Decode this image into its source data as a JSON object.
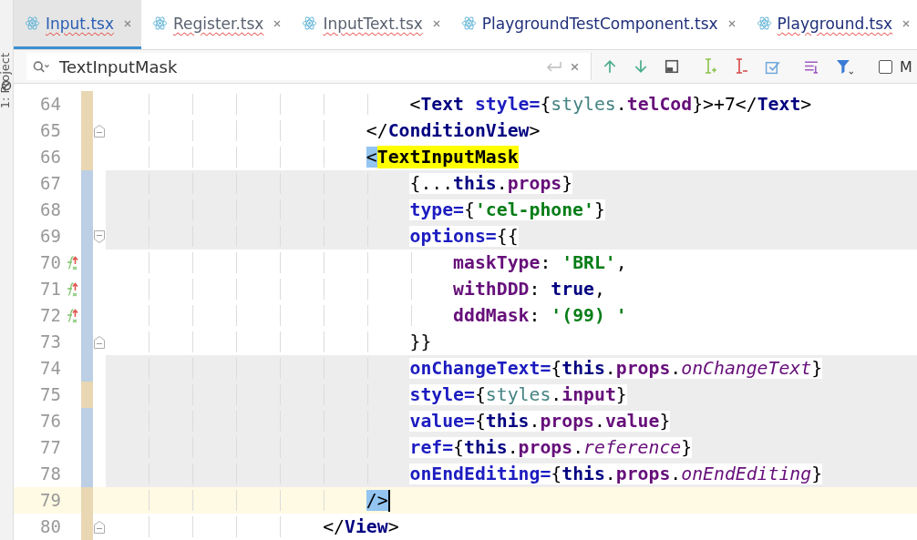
{
  "side_panel": {
    "label": "1: Project"
  },
  "tabs": [
    {
      "label": "Input.tsx",
      "selected": true,
      "has_errors": true,
      "color": "#2c5fb3"
    },
    {
      "label": "Register.tsx",
      "selected": false,
      "has_errors": true,
      "color": "#5a6270"
    },
    {
      "label": "InputText.tsx",
      "selected": false,
      "has_errors": true,
      "color": "#5a6270"
    },
    {
      "label": "PlaygroundTestComponent.tsx",
      "selected": false,
      "has_errors": false,
      "color": "#1f2f7a"
    },
    {
      "label": "Playground.tsx",
      "selected": false,
      "has_errors": true,
      "color": "#1f2f7a"
    }
  ],
  "search": {
    "value": "TextInputMask",
    "match_case": {
      "label": "M",
      "checked": false
    }
  },
  "lines": [
    {
      "number": "64",
      "modified": true,
      "highlighted": false,
      "current": false,
      "fold_start": false,
      "fold_end": false,
      "inline_icon": false,
      "tokens": [
        {
          "plain": "                            <"
        },
        {
          "tag": "Text"
        },
        {
          "attr": " style="
        },
        {
          "plain": "{"
        },
        {
          "ref": "styles"
        },
        {
          "plain": "."
        },
        {
          "prop": "telCod"
        },
        {
          "plain": "}>+7</"
        },
        {
          "tag": "Text"
        },
        {
          "plain": ">"
        }
      ]
    },
    {
      "number": "65",
      "modified": true,
      "highlighted": false,
      "current": false,
      "fold_start": false,
      "fold_end": true,
      "inline_icon": false,
      "tokens": [
        {
          "plain": "                        </"
        },
        {
          "tag": "ConditionView"
        },
        {
          "plain": ">"
        }
      ]
    },
    {
      "number": "66",
      "modified": true,
      "highlighted": false,
      "current": false,
      "fold_start": false,
      "fold_end": false,
      "inline_icon": false,
      "tokens": [
        {
          "match": "                        <"
        },
        {
          "search": "TextInputMask"
        }
      ]
    },
    {
      "number": "67",
      "modified": false,
      "highlighted": true,
      "current": false,
      "fold_start": false,
      "fold_end": false,
      "inline_icon": false,
      "tokens": [
        {
          "plain": "                            {..."
        },
        {
          "kw": "this"
        },
        {
          "plain": "."
        },
        {
          "prop": "props"
        },
        {
          "plain": "}"
        }
      ]
    },
    {
      "number": "68",
      "modified": false,
      "highlighted": true,
      "current": false,
      "fold_start": false,
      "fold_end": false,
      "inline_icon": false,
      "tokens": [
        {
          "attr": "                            type="
        },
        {
          "plain": "{"
        },
        {
          "str": "'cel-phone'"
        },
        {
          "plain": "}"
        }
      ]
    },
    {
      "number": "69",
      "modified": false,
      "highlighted": true,
      "current": false,
      "fold_start": true,
      "fold_end": false,
      "inline_icon": false,
      "tokens": [
        {
          "attr": "                            options="
        },
        {
          "plain": "{{"
        }
      ]
    },
    {
      "number": "70",
      "modified": false,
      "highlighted": false,
      "current": false,
      "fold_start": false,
      "fold_end": false,
      "inline_icon": true,
      "tokens": [
        {
          "prop": "                                maskType"
        },
        {
          "plain": ": "
        },
        {
          "str": "'BRL'"
        },
        {
          "plain": ","
        }
      ]
    },
    {
      "number": "71",
      "modified": false,
      "highlighted": false,
      "current": false,
      "fold_start": false,
      "fold_end": false,
      "inline_icon": true,
      "tokens": [
        {
          "prop": "                                withDDD"
        },
        {
          "plain": ": "
        },
        {
          "kw": "true"
        },
        {
          "plain": ","
        }
      ]
    },
    {
      "number": "72",
      "modified": false,
      "highlighted": false,
      "current": false,
      "fold_start": false,
      "fold_end": false,
      "inline_icon": true,
      "tokens": [
        {
          "prop": "                                dddMask"
        },
        {
          "plain": ": "
        },
        {
          "str": "'(99) '"
        }
      ]
    },
    {
      "number": "73",
      "modified": false,
      "highlighted": false,
      "current": false,
      "fold_start": false,
      "fold_end": true,
      "inline_icon": false,
      "tokens": [
        {
          "plain": "                            }}"
        }
      ]
    },
    {
      "number": "74",
      "modified": false,
      "highlighted": true,
      "current": false,
      "fold_start": false,
      "fold_end": false,
      "inline_icon": false,
      "tokens": [
        {
          "attr": "                            onChangeText="
        },
        {
          "plain": "{"
        },
        {
          "kw": "this"
        },
        {
          "plain": "."
        },
        {
          "prop": "props"
        },
        {
          "plain": "."
        },
        {
          "italic": "onChangeText"
        },
        {
          "plain": "}"
        }
      ]
    },
    {
      "number": "75",
      "modified": true,
      "highlighted": true,
      "current": false,
      "fold_start": false,
      "fold_end": false,
      "inline_icon": false,
      "tokens": [
        {
          "attr": "                            style="
        },
        {
          "plain": "{"
        },
        {
          "ref": "styles"
        },
        {
          "plain": "."
        },
        {
          "prop": "input"
        },
        {
          "plain": "}"
        }
      ]
    },
    {
      "number": "76",
      "modified": false,
      "highlighted": true,
      "current": false,
      "fold_start": false,
      "fold_end": false,
      "inline_icon": false,
      "tokens": [
        {
          "attr": "                            value="
        },
        {
          "plain": "{"
        },
        {
          "kw": "this"
        },
        {
          "plain": "."
        },
        {
          "prop": "props"
        },
        {
          "plain": "."
        },
        {
          "prop": "value"
        },
        {
          "plain": "}"
        }
      ]
    },
    {
      "number": "77",
      "modified": false,
      "highlighted": true,
      "current": false,
      "fold_start": false,
      "fold_end": false,
      "inline_icon": false,
      "tokens": [
        {
          "attr": "                            ref="
        },
        {
          "plain": "{"
        },
        {
          "kw": "this"
        },
        {
          "plain": "."
        },
        {
          "prop": "props"
        },
        {
          "plain": "."
        },
        {
          "italic": "reference"
        },
        {
          "plain": "}"
        }
      ]
    },
    {
      "number": "78",
      "modified": false,
      "highlighted": true,
      "current": false,
      "fold_start": false,
      "fold_end": false,
      "inline_icon": false,
      "tokens": [
        {
          "attr": "                            onEndEditing="
        },
        {
          "plain": "{"
        },
        {
          "kw": "this"
        },
        {
          "plain": "."
        },
        {
          "prop": "props"
        },
        {
          "plain": "."
        },
        {
          "italic": "onEndEditing"
        },
        {
          "plain": "}"
        }
      ]
    },
    {
      "number": "79",
      "modified": true,
      "highlighted": false,
      "current": true,
      "fold_start": false,
      "fold_end": false,
      "inline_icon": false,
      "tokens": [
        {
          "match": "                        />"
        }
      ]
    },
    {
      "number": "80",
      "modified": true,
      "highlighted": false,
      "current": false,
      "fold_start": false,
      "fold_end": true,
      "inline_icon": false,
      "tokens": [
        {
          "plain": "                    </"
        },
        {
          "tag": "View"
        },
        {
          "plain": ">"
        }
      ]
    }
  ]
}
